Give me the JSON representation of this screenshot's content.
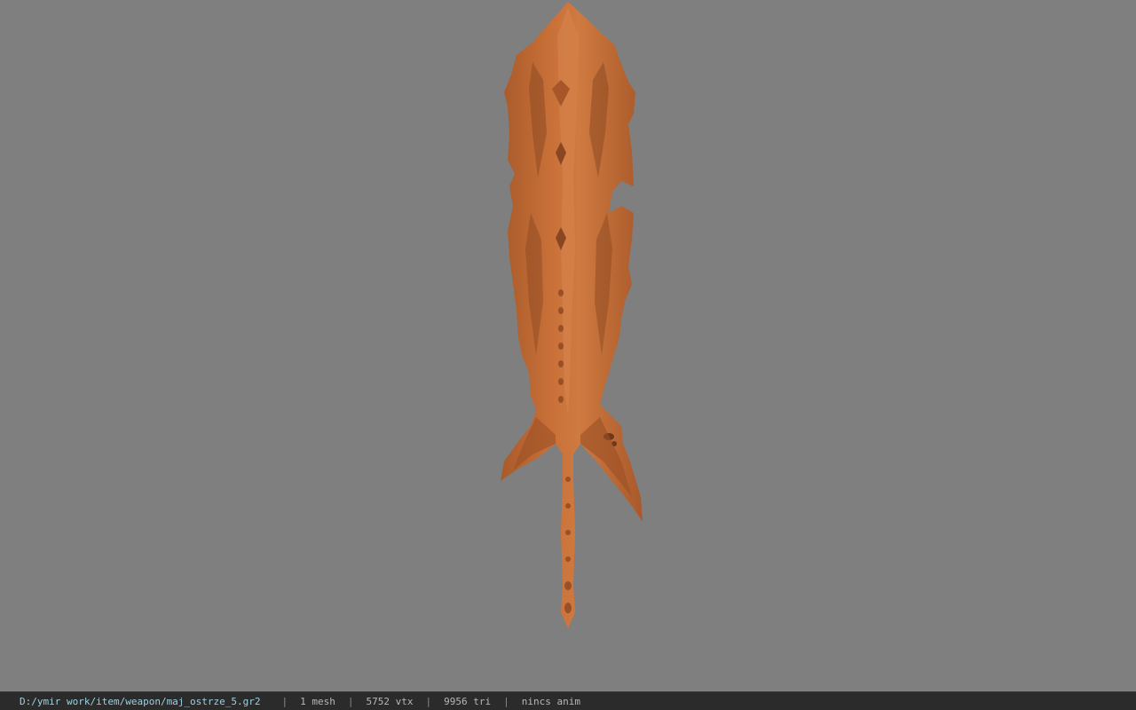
{
  "viewport": {
    "background": "#7f7f7f",
    "model_color": "#c06a33",
    "model_shadow": "#8f4a22",
    "model_highlight": "#d98a4f"
  },
  "statusbar": {
    "file_path": "D:/ymir work/item/weapon/maj_ostrze_5.gr2",
    "separator": "|",
    "mesh_count": "1 mesh",
    "vertex_count": "5752 vtx",
    "triangle_count": "9956 tri",
    "animation": "nincs anim"
  }
}
